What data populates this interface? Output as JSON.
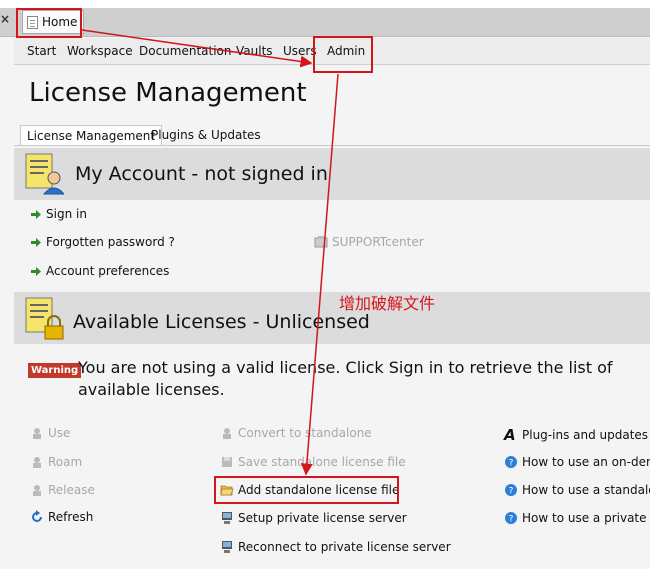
{
  "window": {
    "close_glyph": "×",
    "home_tab": "Home"
  },
  "menu": [
    "Start",
    "Workspace",
    "Documentation",
    "Vaults",
    "Users",
    "Admin"
  ],
  "page_title": "License Management",
  "subtabs": [
    "License Management",
    "Plugins & Updates"
  ],
  "account": {
    "title": "My Account - not signed in",
    "links": [
      "Sign in",
      "Forgotten password ?",
      "Account preferences"
    ],
    "support": "SUPPORTcenter"
  },
  "licenses": {
    "title": "Available Licenses - Unlicensed",
    "warning_badge": "Warning",
    "warning_text": "You are not using a valid license. Click Sign in to retrieve the list of available licenses.",
    "col1": [
      "Use",
      "Roam",
      "Release",
      "Refresh"
    ],
    "col2": [
      "Convert to standalone",
      "Save standalone license file",
      "Add standalone license file",
      "Setup private license server",
      "Reconnect to private license server"
    ],
    "col3": [
      "Plug-ins and updates",
      "How to use an on-demand",
      "How to use a standalone",
      "How to use a private"
    ]
  },
  "annotation": {
    "text": "增加破解文件",
    "color": "#d3161b"
  },
  "colors": {
    "arrow_green": "#2e8b2e",
    "disabled": "#a7a7a7",
    "section_band": "#dcdcdc",
    "warning_red": "#c0392b"
  }
}
